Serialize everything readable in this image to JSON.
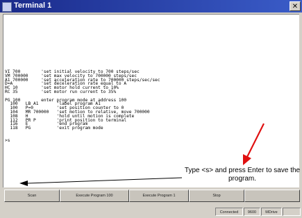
{
  "window": {
    "title": "Terminal 1",
    "close_glyph": "✕"
  },
  "terminal": {
    "lines": [
      "VI 700        'set initial velocity to 700 steps/sec",
      "VM 700000     'set max velocity to 700000 steps/sec",
      "A1 700000     'set acceleration rate to 700000 steps/sec/sec",
      "D=A           'set deceleration rate equal to A",
      "HC 10         'set motor hold current to 10%",
      "RC 35         'set motor run current to 35%",
      "",
      "PG 100        enter program mode at address 100",
      "  100   LB A1       'label program A1",
      "  100   P=0         'set position counter to 0",
      "  104   MR 700000   'set motion to relative, move 700000",
      "  108   H           'hold until motion is complete",
      "  112   PR P        'print position to terminal",
      "  116   E           'end program",
      "  118   PG          'exit program mode",
      "",
      "",
      ">s"
    ]
  },
  "annotation": {
    "text": "Type <s> and press Enter to save the program."
  },
  "function_buttons": [
    "Scan",
    "Execute Program 100",
    "Execute Program 1",
    "Stop",
    ""
  ],
  "status": [
    "Connected",
    "9600",
    "MDrive",
    ""
  ]
}
